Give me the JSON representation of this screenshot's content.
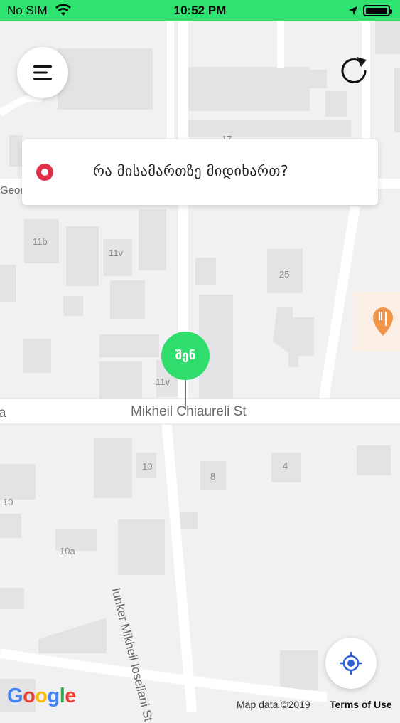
{
  "status_bar": {
    "carrier": "No SIM",
    "time": "10:52 PM",
    "background_color": "#2ee36f"
  },
  "map": {
    "street_main": "Mikheil Chiaureli St",
    "street_side": "Iunker Mikheil Ioseliani St",
    "street_partial_top": "Geor",
    "street_partial_left": "a",
    "building_labels": [
      "11b",
      "11v",
      "25",
      "11v",
      "17",
      "10",
      "8",
      "4",
      "10",
      "10a"
    ]
  },
  "search": {
    "prompt": "რა მისამართზე მიდიხართ?",
    "accent_color": "#e0304a"
  },
  "user_pin": {
    "label": "შენ",
    "color": "#2edd6c"
  },
  "icons": {
    "menu": "hamburger-menu-icon",
    "refresh": "refresh-icon",
    "destination": "destination-marker-icon",
    "locate": "my-location-icon",
    "restaurant": "restaurant-marker-icon"
  },
  "footer": {
    "google": "Google",
    "map_data": "Map data ©2019",
    "terms": "Terms of Use"
  }
}
